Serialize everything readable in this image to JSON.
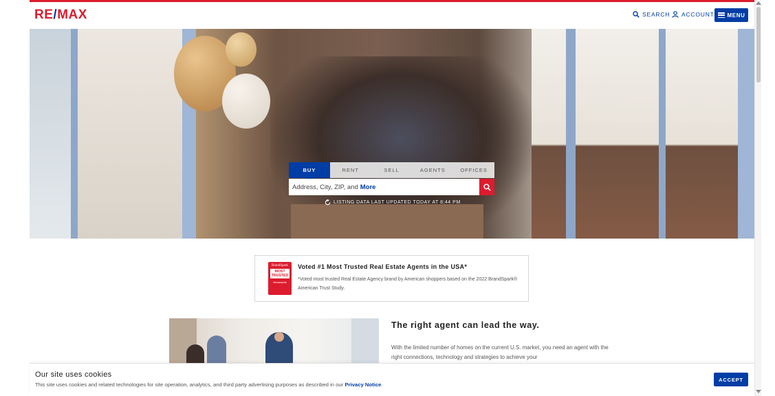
{
  "header": {
    "logo_left": "RE",
    "logo_slash": "/",
    "logo_right": "MAX",
    "search_label": "SEARCH",
    "account_label": "ACCOUNT",
    "menu_label": "MENU"
  },
  "search": {
    "tabs": [
      {
        "label": "BUY",
        "active": true
      },
      {
        "label": "RENT",
        "active": false
      },
      {
        "label": "SELL",
        "active": false
      },
      {
        "label": "AGENTS",
        "active": false
      },
      {
        "label": "OFFICES",
        "active": false
      }
    ],
    "placeholder": "Address, City, ZIP, and",
    "placeholder_more": "More",
    "updated_text": "LISTING DATA LAST UPDATED TODAY AT 8:44 PM"
  },
  "trust": {
    "badge_brand": "BrandSpark",
    "badge_line1": "MOST",
    "badge_line2": "TRUSTED",
    "badge_foot": "Newsweek",
    "title": "Voted #1 Most Trusted Real Estate Agents in the USA*",
    "body": "*Voted most trusted Real Estate Agency brand by American shoppers based on the 2022 BrandSpark® American Trust Study."
  },
  "agent": {
    "title": "The right agent can lead the way.",
    "body": "With the limited number of homes on the current U.S. market, you need an agent with the right connections, technology and strategies to achieve your"
  },
  "cookie": {
    "title": "Our site uses cookies",
    "text": "This site uses cookies and related technologies for site operation, analytics, and third party advertising purposes as described in our",
    "privacy_link": "Privacy Notice",
    "text_end": ".",
    "accept_label": "ACCEPT"
  },
  "colors": {
    "brand_red": "#dc1c2e",
    "brand_blue": "#003da5"
  }
}
